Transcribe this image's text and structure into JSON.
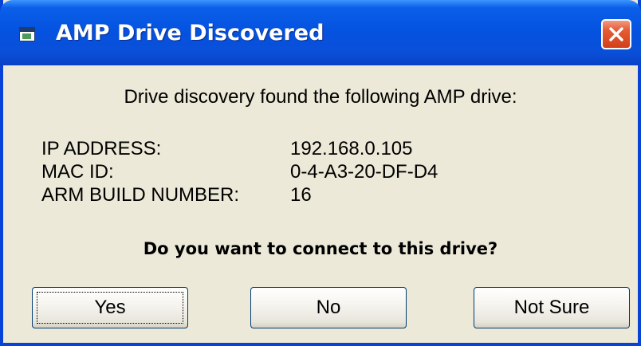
{
  "window": {
    "title": "AMP Drive Discovered",
    "close_label": "Close"
  },
  "message": "Drive discovery found the following AMP drive:",
  "info": {
    "ip_label": "IP ADDRESS:",
    "ip_value": "192.168.0.105",
    "mac_label": "MAC ID:",
    "mac_value": "0-4-A3-20-DF-D4",
    "build_label": "ARM BUILD NUMBER:",
    "build_value": "16"
  },
  "question": "Do you want to connect to this drive?",
  "buttons": {
    "yes": "Yes",
    "no": "No",
    "not_sure": "Not Sure"
  },
  "colors": {
    "titlebar": "#0553e1",
    "dialog_background": "#ece9d8",
    "close_button": "#d2401b"
  },
  "icons": {
    "app": "app-window-icon",
    "close": "close-icon"
  }
}
